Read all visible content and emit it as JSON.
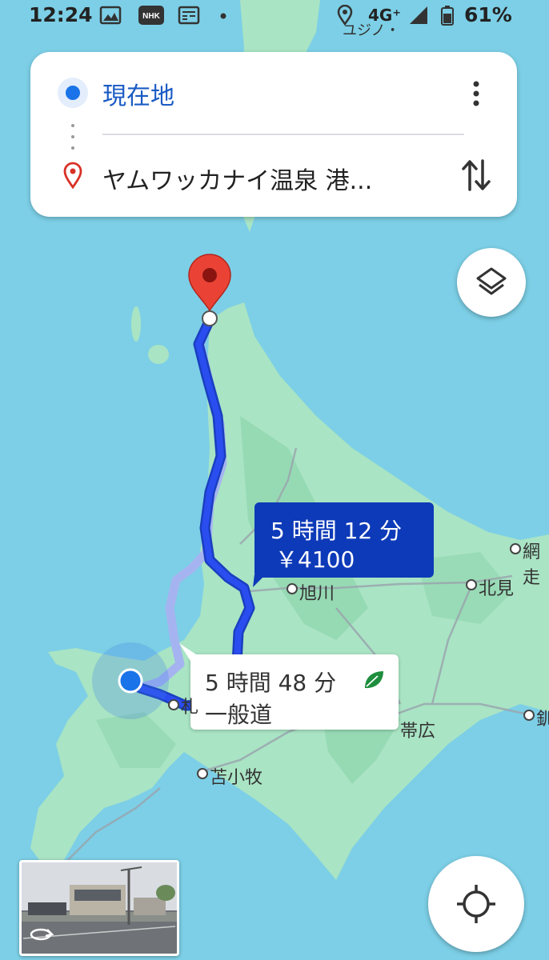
{
  "status_bar": {
    "time": "12:24",
    "network": "4G⁺",
    "battery": "61%",
    "icons": [
      "gallery-icon",
      "nhk-icon",
      "news-icon",
      "dot-icon",
      "location-icon",
      "signal-icon",
      "battery-icon"
    ],
    "nhk_label": "NHK"
  },
  "top_map_label": "ユジノ・",
  "search": {
    "origin": "現在地",
    "destination": "ヤムワッカナイ温泉 港..."
  },
  "routes": {
    "primary": {
      "duration": "5 時間 12 分",
      "fare": "￥4100"
    },
    "alternative": {
      "duration": "5 時間 48 分",
      "type": "一般道"
    }
  },
  "cities": {
    "asahikawa": "旭川",
    "kitami": "北見",
    "obihiro": "帯広",
    "tomakomai": "苫小牧",
    "abashiri": "網走",
    "kushiro": "釧",
    "sapporo": "札"
  },
  "colors": {
    "water": "#7ccfe6",
    "land": "#a9e4c4",
    "land_dark": "#8fd6ae",
    "route_primary": "#1a33e8",
    "route_alt": "#a5b4f0",
    "label_primary_bg": "#0d3ab8",
    "pin": "#ea4335",
    "accent": "#1a73e8"
  }
}
